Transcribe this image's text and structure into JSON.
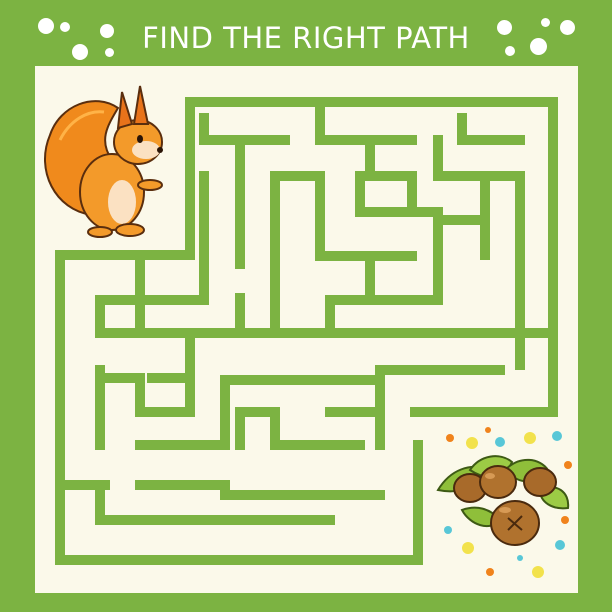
{
  "title": "FIND THE RIGHT PATH",
  "colors": {
    "background": "#7cb342",
    "board": "#fbf9ea",
    "maze_wall": "#7cb342",
    "title_text": "#ffffff"
  },
  "characters": {
    "start": "squirrel-icon",
    "goal": "hazelnuts-icon"
  }
}
